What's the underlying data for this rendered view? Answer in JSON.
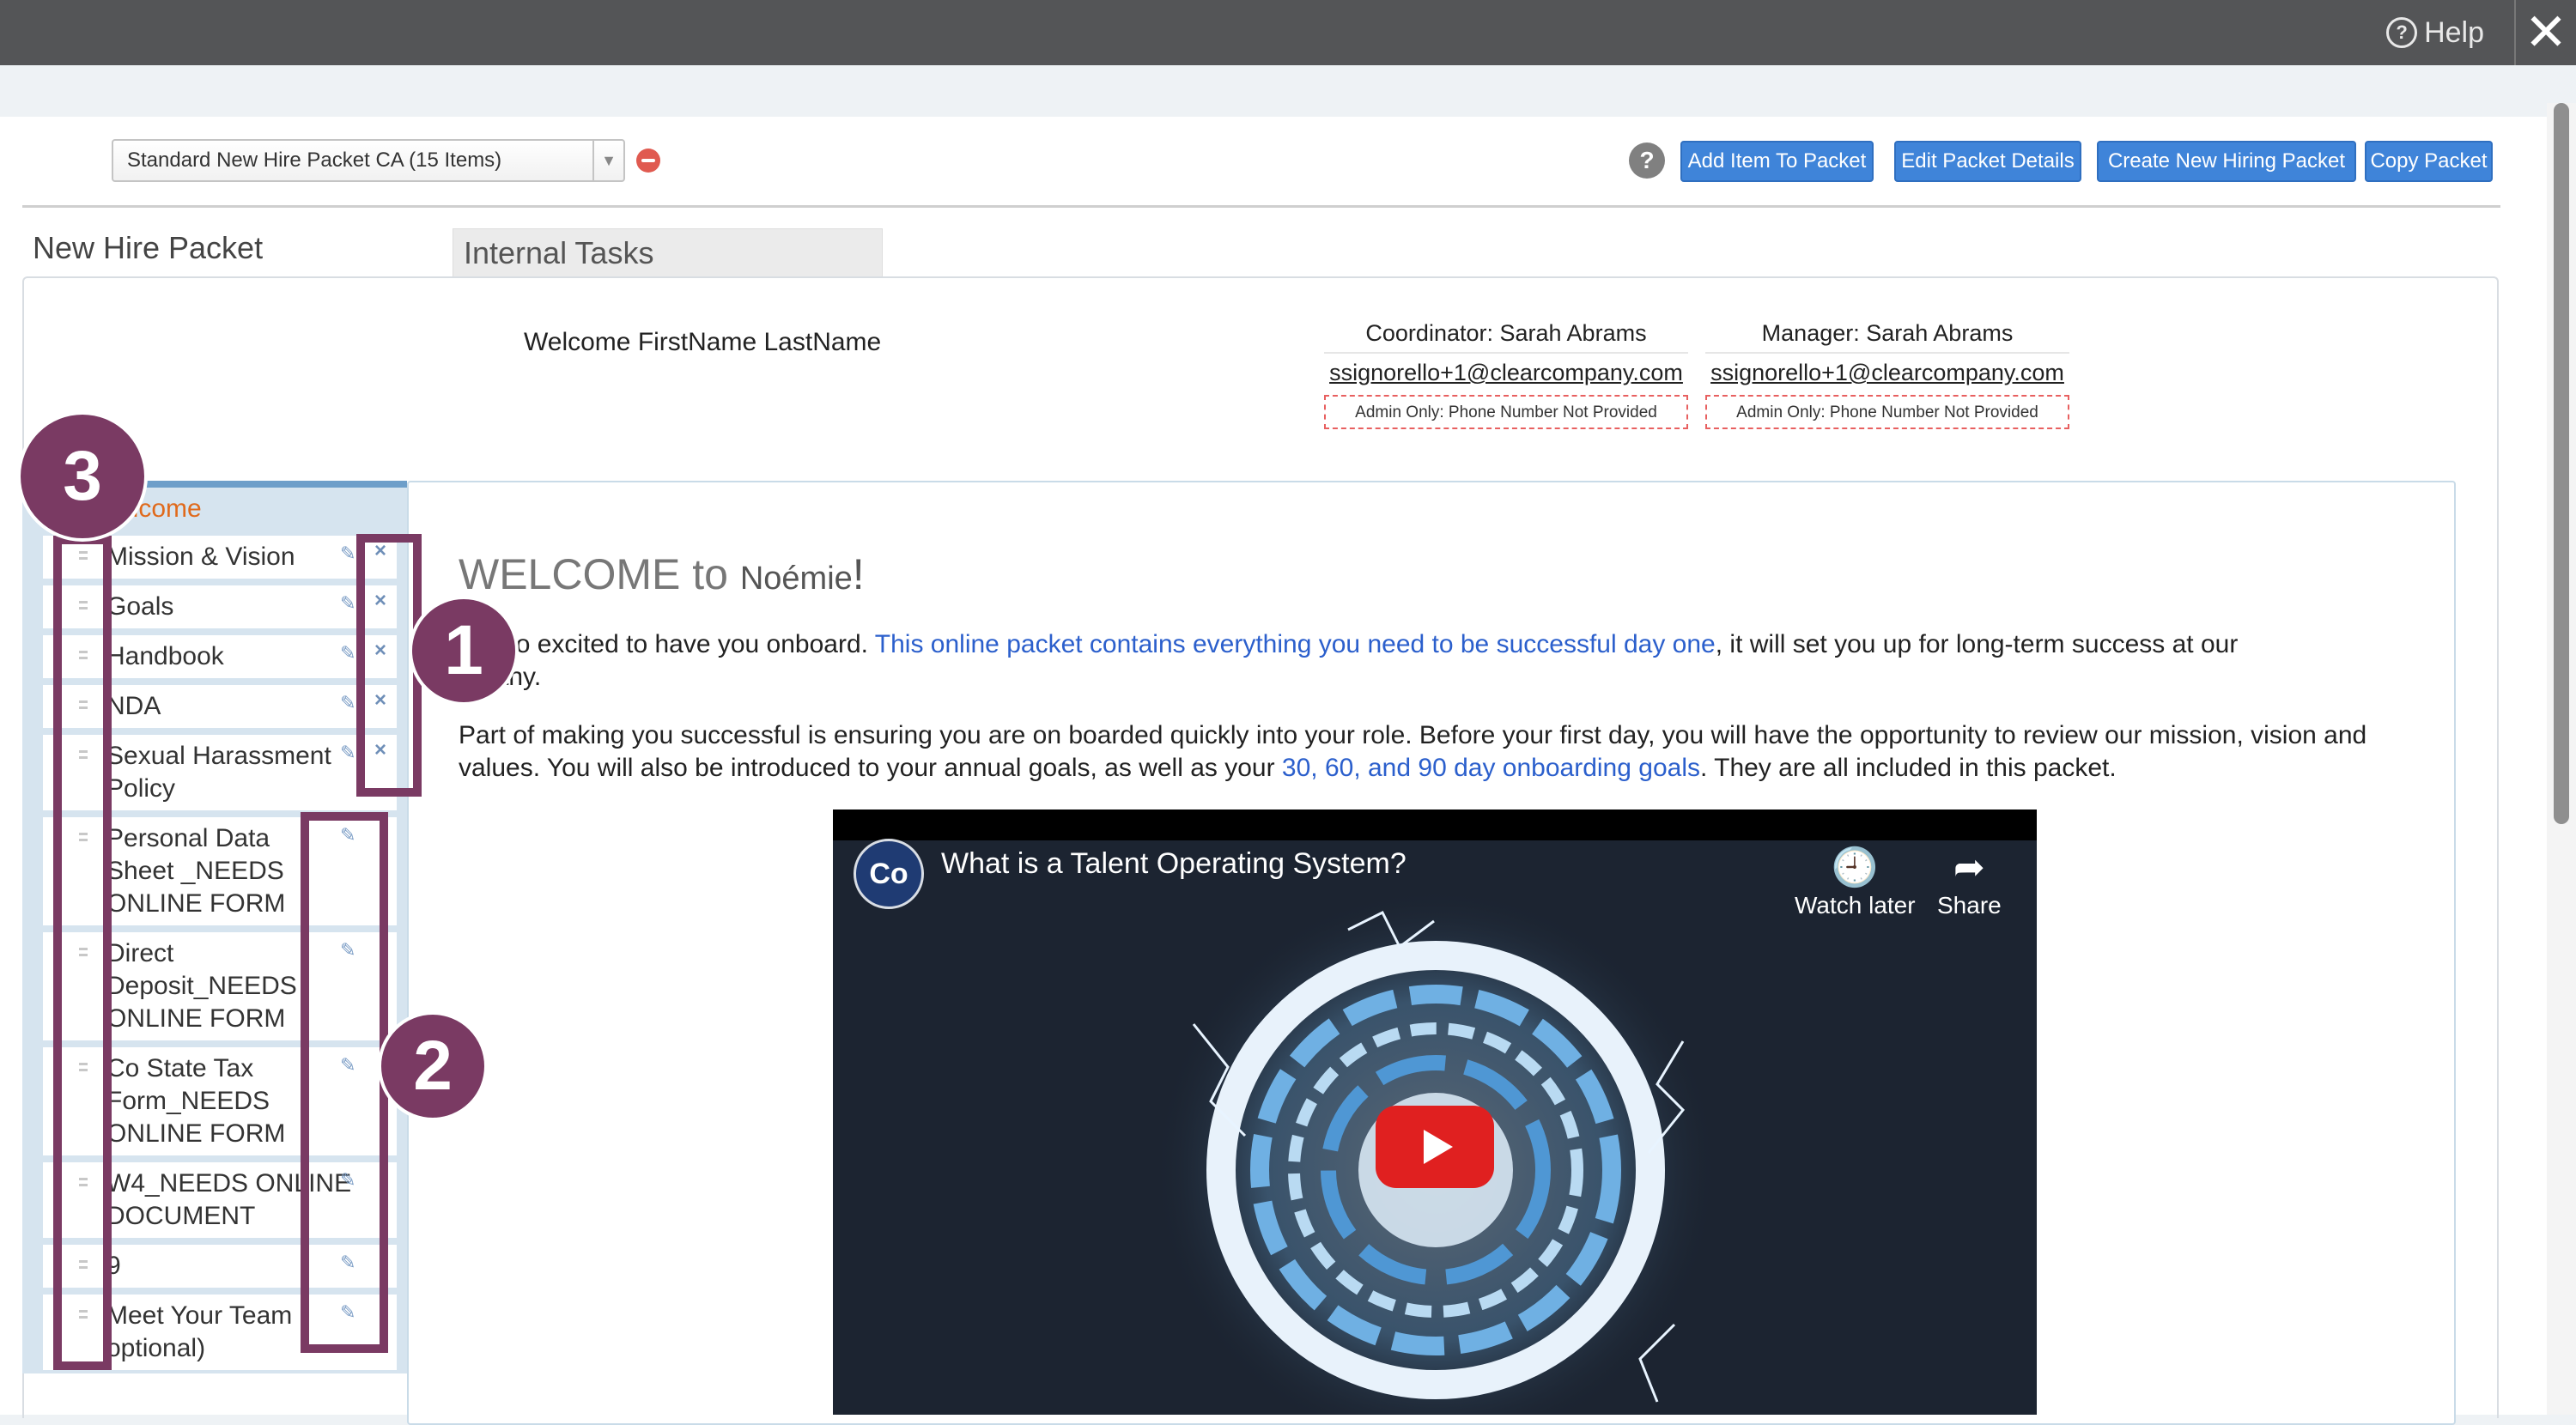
{
  "topbar": {
    "help_label": "Help",
    "close_symbol": "✕"
  },
  "packet": {
    "selected": "Standard New Hire Packet CA (15 Items)",
    "help_symbol": "?",
    "buttons": {
      "add_item": "Add Item To Packet",
      "edit_details": "Edit Packet Details",
      "create_new": "Create New Hiring Packet",
      "copy": "Copy Packet"
    }
  },
  "tabs": {
    "new_hire": "New Hire Packet",
    "internal": "Internal Tasks"
  },
  "welcome_name": "Welcome FirstName LastName",
  "coordinator": {
    "title": "Coordinator: Sarah Abrams",
    "email": "ssignorello+1@clearcompany.com",
    "phone_note": "Admin Only: Phone Number Not Provided"
  },
  "manager": {
    "title": "Manager: Sarah Abrams",
    "email": "ssignorello+1@clearcompany.com",
    "phone_note": "Admin Only: Phone Number Not Provided"
  },
  "sidebar": {
    "items": [
      {
        "label": "elcome",
        "active": true
      },
      {
        "label": "Mission & Vision"
      },
      {
        "label": "Goals"
      },
      {
        "label": "Handbook"
      },
      {
        "label": "NDA"
      },
      {
        "label": "Sexual Harassment\nPolicy"
      },
      {
        "label": "Personal Data\nSheet _NEEDS\nONLINE FORM"
      },
      {
        "label": "Direct\nDeposit_NEEDS\nONLINE FORM"
      },
      {
        "label": "Co State Tax\nForm_NEEDS\nONLINE FORM"
      },
      {
        "label": "W4_NEEDS ONLINE\nDOCUMENT"
      },
      {
        "label": "9"
      },
      {
        "label": "Meet Your Team\noptional)"
      }
    ]
  },
  "main": {
    "title_welcome": "WELCOME to ",
    "title_name": "Noémie",
    "title_bang": "!",
    "p1_before": "are so excited to have you onboard. ",
    "p1_link": "This online packet contains everything you need to be successful day one",
    "p1_after": ", it will set you up for long-term success at our",
    "p1_line2": "mpany.",
    "p2_before": "Part of making you successful is ensuring you are on boarded quickly into your role. Before your first day, you will have the opportunity to review our mission, vision and values. You will also be introduced to your annual goals, as well as your ",
    "p2_link": "30, 60, and 90 day onboarding goals",
    "p2_after": ". They are all included in this packet."
  },
  "video": {
    "title": "What is a Talent Operating System?",
    "watch_later": "Watch later",
    "share": "Share",
    "logo_text": "Co"
  },
  "annotations": {
    "one": "1",
    "two": "2",
    "three": "3"
  },
  "colors": {
    "accent": "#3f84d9",
    "annotation": "#7a3a63",
    "active_item": "#e06a1c",
    "link": "#2b5fcc"
  }
}
